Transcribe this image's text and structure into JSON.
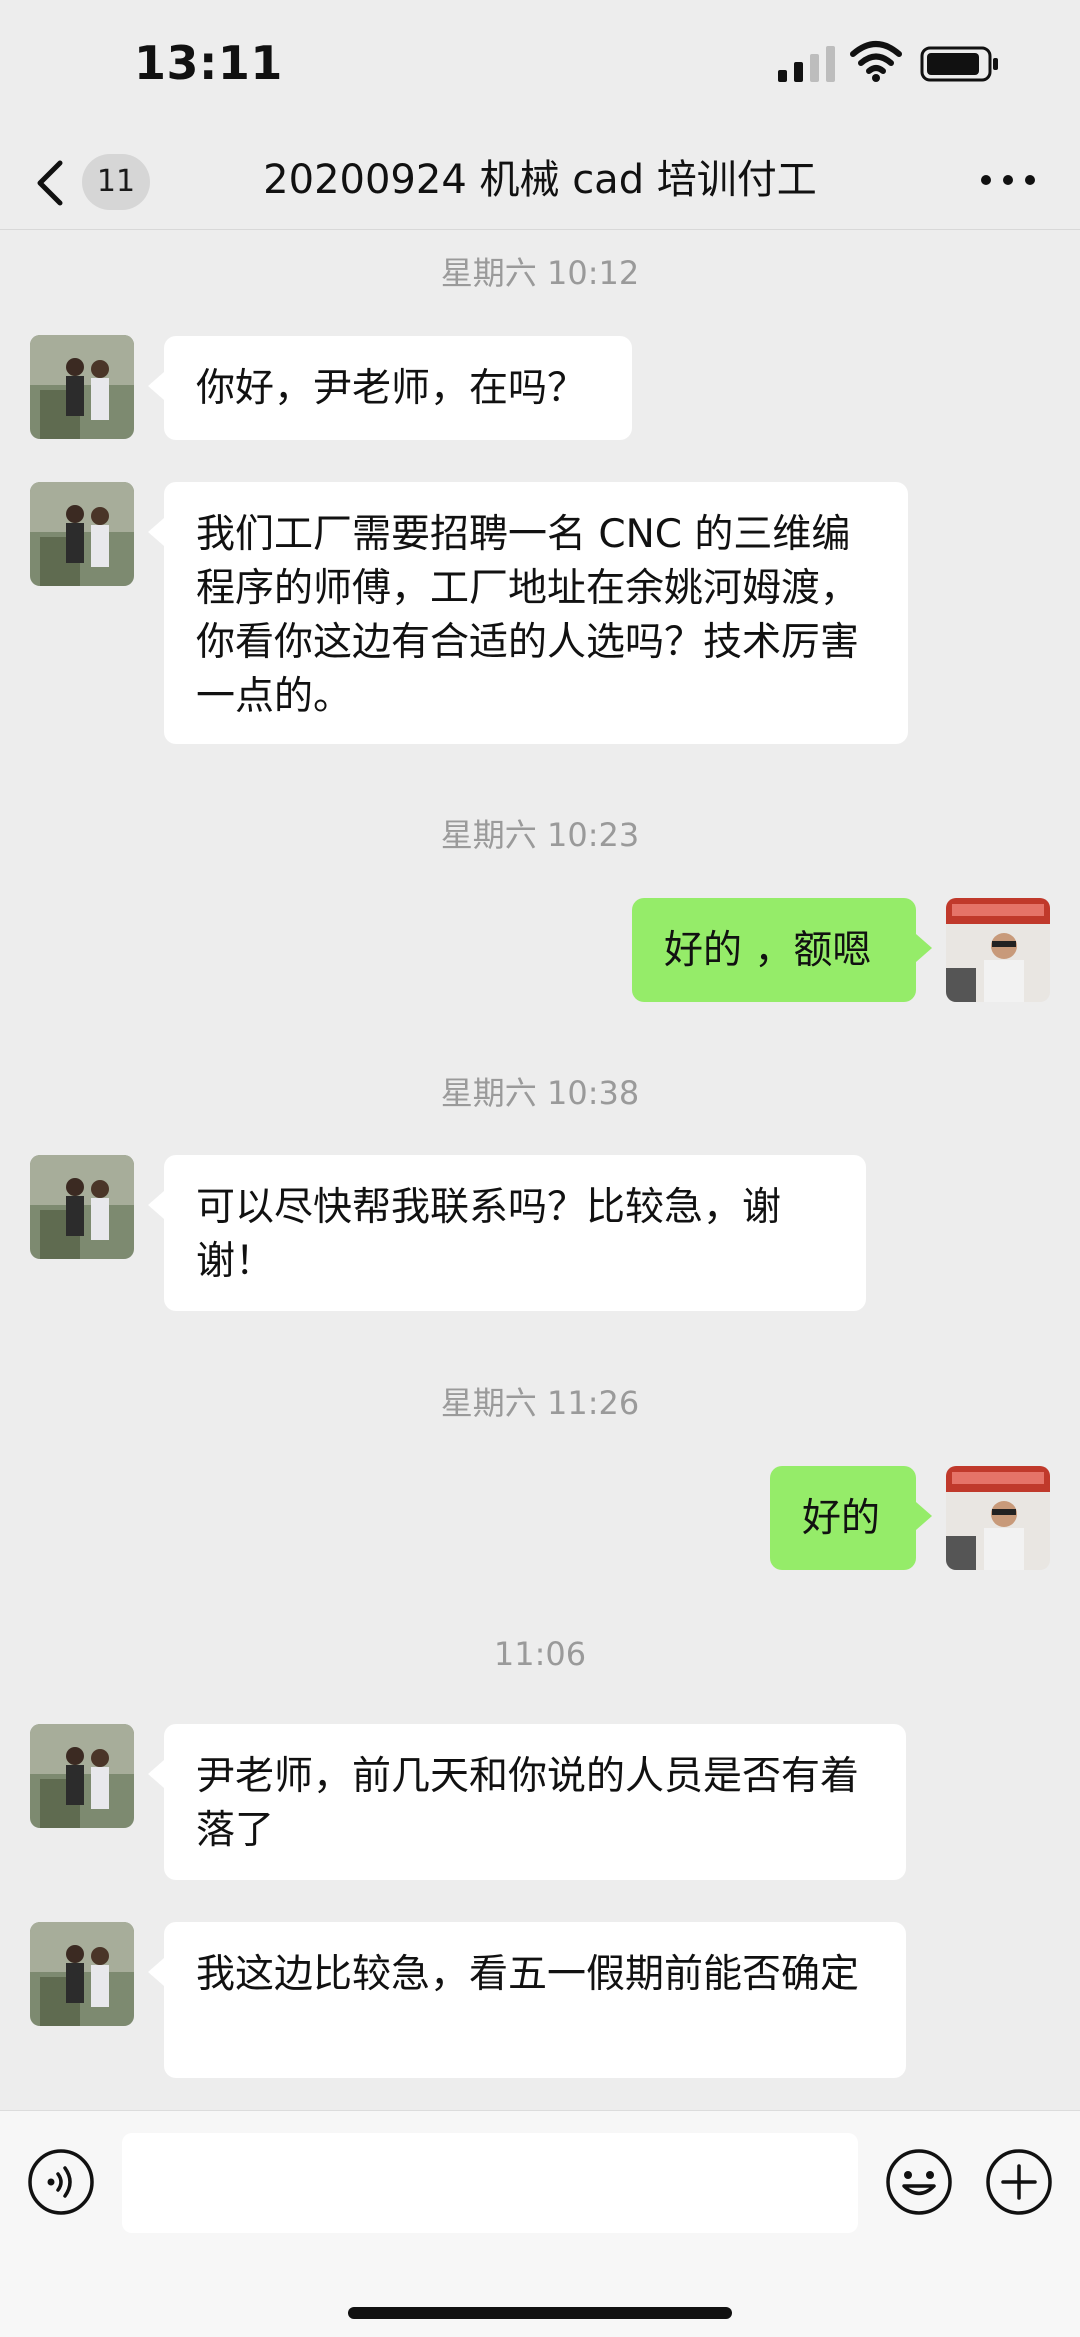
{
  "status_bar": {
    "time": "13:11",
    "icons": [
      "signal-icon",
      "wifi-icon",
      "battery-icon"
    ]
  },
  "nav": {
    "back_icon": "chevron-left-icon",
    "unread_count": "11",
    "title": "20200924 机械 cad 培训付工",
    "more_icon": "more-dots-icon"
  },
  "messages": {
    "items": [
      {
        "type": "time",
        "text": "星期六 10:12"
      },
      {
        "type": "text",
        "side": "left",
        "text": "你好，尹老师，在吗？"
      },
      {
        "type": "text",
        "side": "left",
        "text": "我们工厂需要招聘一名 CNC 的三维编程序的师傅，工厂地址在余姚河姆渡，你看你这边有合适的人选吗？技术厉害一点的。"
      },
      {
        "type": "time",
        "text": "星期六 10:23"
      },
      {
        "type": "text",
        "side": "right",
        "text": "好的 ，额嗯"
      },
      {
        "type": "time",
        "text": "星期六 10:38"
      },
      {
        "type": "text",
        "side": "left",
        "text": "可以尽快帮我联系吗？比较急，谢谢！"
      },
      {
        "type": "time",
        "text": "星期六 11:26"
      },
      {
        "type": "text",
        "side": "right",
        "text": "好的"
      },
      {
        "type": "time",
        "text": "11:06"
      },
      {
        "type": "text",
        "side": "left",
        "text": "尹老师，前几天和你说的人员是否有着落了"
      },
      {
        "type": "text",
        "side": "left",
        "text": "我这边比较急，看五一假期前能否确定"
      }
    ]
  },
  "input_bar": {
    "voice_icon": "voice-icon",
    "text_value": "",
    "emoji_icon": "emoji-icon",
    "plus_icon": "plus-icon"
  },
  "colors": {
    "background": "#ededed",
    "incoming_bubble": "#ffffff",
    "outgoing_bubble": "#95ec69",
    "timestamp_text": "#9a9a9a"
  }
}
